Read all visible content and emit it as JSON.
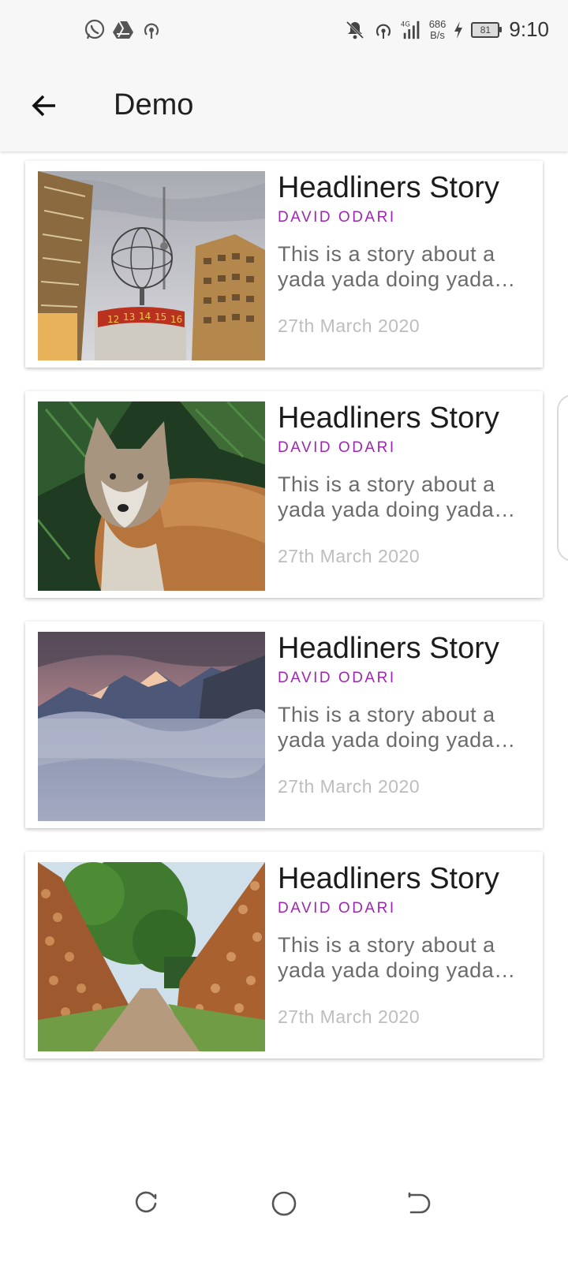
{
  "status_bar": {
    "time": "9:10",
    "net_speed_value": "686",
    "net_speed_unit": "B/s",
    "network_type": "4G",
    "battery_level": "81",
    "left_icons": [
      "whatsapp-icon",
      "drive-icon",
      "hotspot-icon"
    ],
    "right_icons": [
      "mute-icon",
      "hotspot-icon",
      "signal-icon",
      "charging-icon",
      "battery-icon"
    ]
  },
  "app_bar": {
    "title": "Demo",
    "back_icon": "arrow-back-icon"
  },
  "stories": [
    {
      "image": "world-clock-tower",
      "title": "Headliners Story",
      "author": "DAVID ODARI",
      "description": "This is a story about a yada yada doing yada yada yada",
      "date": "27th March 2020"
    },
    {
      "image": "fox",
      "title": "Headliners Story",
      "author": "DAVID ODARI",
      "description": "This is a story about a yada yada doing yada yada yada",
      "date": "27th March 2020"
    },
    {
      "image": "mountains-clouds",
      "title": "Headliners Story",
      "author": "DAVID ODARI",
      "description": "This is a story about a yada yada doing yada yada yada",
      "date": "27th March 2020"
    },
    {
      "image": "log-piles-path",
      "title": "Headliners Story",
      "author": "DAVID ODARI",
      "description": "This is a story about a yada yada doing yada yada yada",
      "date": "27th March 2020"
    }
  ],
  "colors": {
    "author": "#9c27b0",
    "title": "#1c1c1c",
    "description": "#6b6b6b",
    "date": "#bdbdbd",
    "bar_background": "#f7f7f7"
  },
  "nav_bar": {
    "buttons": [
      "recent-apps-icon",
      "home-icon",
      "back-nav-icon"
    ]
  }
}
